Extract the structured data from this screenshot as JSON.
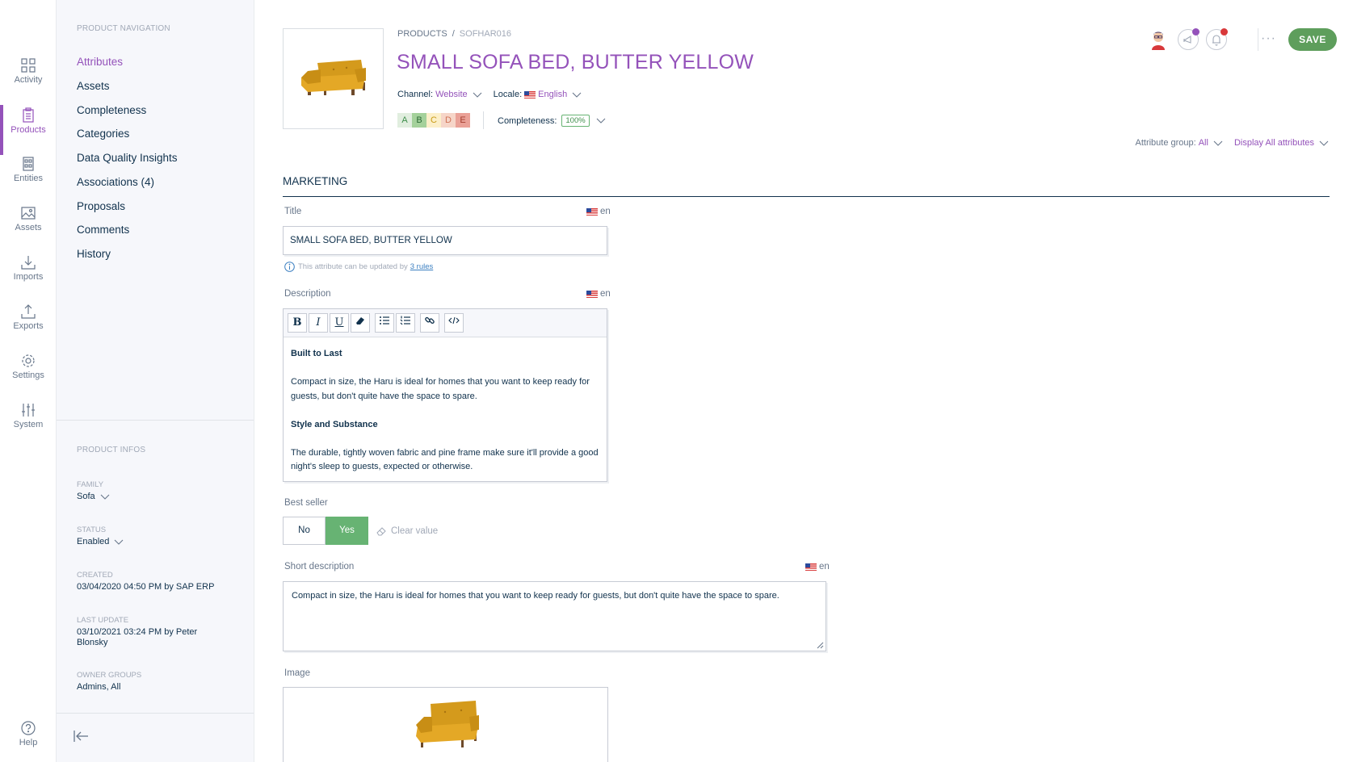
{
  "mainnav": {
    "items": [
      {
        "label": "Activity",
        "icon": "activity-grid-icon"
      },
      {
        "label": "Products",
        "icon": "clipboard-icon"
      },
      {
        "label": "Entities",
        "icon": "entities-icon"
      },
      {
        "label": "Assets",
        "icon": "image-icon"
      },
      {
        "label": "Imports",
        "icon": "download-icon"
      },
      {
        "label": "Exports",
        "icon": "upload-icon"
      },
      {
        "label": "Settings",
        "icon": "gear-icon"
      },
      {
        "label": "System",
        "icon": "sliders-icon"
      }
    ],
    "help_label": "Help"
  },
  "product_nav": {
    "title": "PRODUCT NAVIGATION",
    "items": [
      {
        "label": "Attributes"
      },
      {
        "label": "Assets"
      },
      {
        "label": "Completeness"
      },
      {
        "label": "Categories"
      },
      {
        "label": "Data Quality Insights"
      },
      {
        "label": "Associations (4)"
      },
      {
        "label": "Proposals"
      },
      {
        "label": "Comments"
      },
      {
        "label": "History"
      }
    ]
  },
  "product_infos": {
    "title": "PRODUCT INFOS",
    "family_label": "FAMILY",
    "family_value": "Sofa",
    "status_label": "STATUS",
    "status_value": "Enabled",
    "created_label": "CREATED",
    "created_value": "03/04/2020 04:50 PM by SAP ERP",
    "updated_label": "LAST UPDATE",
    "updated_value": "03/10/2021 03:24 PM by Peter Blonsky",
    "owner_label": "OWNER GROUPS",
    "owner_value": "Admins, All"
  },
  "header": {
    "breadcrumb_root": "PRODUCTS",
    "breadcrumb_sep": "/",
    "breadcrumb_current": "SOFHAR016",
    "title": "SMALL SOFA BED, BUTTER YELLOW",
    "channel_label": "Channel:",
    "channel_value": "Website",
    "locale_label": "Locale:",
    "locale_value": "English",
    "grades": [
      "A",
      "B",
      "C",
      "D",
      "E"
    ],
    "completeness_label": "Completeness:",
    "completeness_value": "100%",
    "save_label": "SAVE",
    "more_label": "···"
  },
  "filters": {
    "group_label": "Attribute group:",
    "group_value": "All",
    "display_label": "Display All attributes"
  },
  "marketing": {
    "section_title": "MARKETING",
    "title_label": "Title",
    "locale_code": "en",
    "title_value": "SMALL SOFA BED, BUTTER YELLOW",
    "rules_hint": "This attribute can be updated by",
    "rules_link": "3 rules",
    "description_label": "Description",
    "description": [
      {
        "text": "Built to Last",
        "bold": true
      },
      {
        "text": "Compact in size, the Haru is ideal for homes that you want to keep ready for guests, but don't quite have the space to spare.",
        "bold": false
      },
      {
        "text": "Style and Substance",
        "bold": true
      },
      {
        "text": "The durable, tightly woven fabric and pine frame make sure it'll provide a good night's sleep to guests, expected or otherwise.",
        "bold": false
      }
    ],
    "toolbar_buttons": [
      "B",
      "I",
      "U"
    ],
    "best_seller_label": "Best seller",
    "no_label": "No",
    "yes_label": "Yes",
    "best_seller_value": "Yes",
    "clear_label": "Clear value",
    "short_desc_label": "Short description",
    "short_desc_value": "Compact in size, the Haru is ideal for homes that you want to keep ready for guests, but don't quite have the space to spare.",
    "image_label": "Image"
  },
  "colors": {
    "accent": "#9452ba",
    "save": "#5e9e5c",
    "grade_a": "#e1eedf",
    "grade_b": "#a4d19b",
    "grade_c": "#fcefc9",
    "grade_d": "#f6d5c8",
    "grade_e": "#eaa197"
  }
}
